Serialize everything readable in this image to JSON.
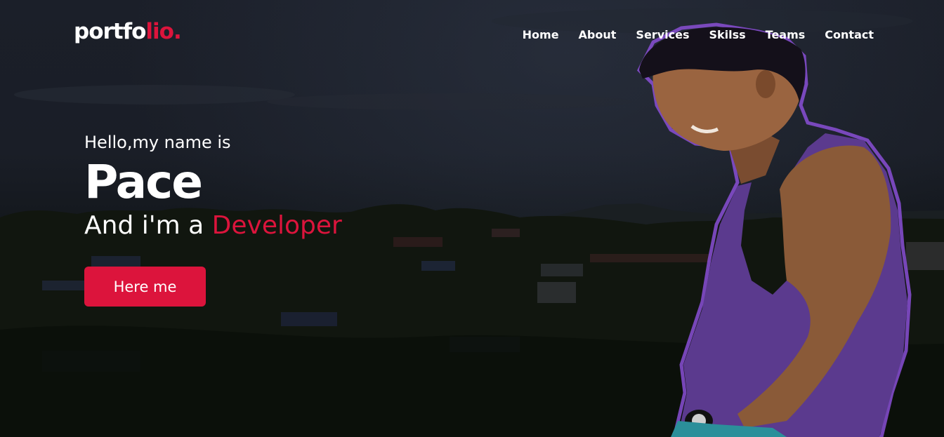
{
  "brand": {
    "logo_main": "portfo",
    "logo_accent": "lio."
  },
  "nav": {
    "items": [
      {
        "label": "Home"
      },
      {
        "label": "About"
      },
      {
        "label": "Services"
      },
      {
        "label": "Skilss"
      },
      {
        "label": "Teams"
      },
      {
        "label": "Contact"
      }
    ]
  },
  "hero": {
    "greeting": "Hello,my name is",
    "name": "Pace",
    "role_prefix": "And i'm a ",
    "role": "Developer",
    "cta_label": "Here me"
  },
  "colors": {
    "accent": "#dc143c",
    "text": "#ffffff",
    "background": "#15191f"
  }
}
